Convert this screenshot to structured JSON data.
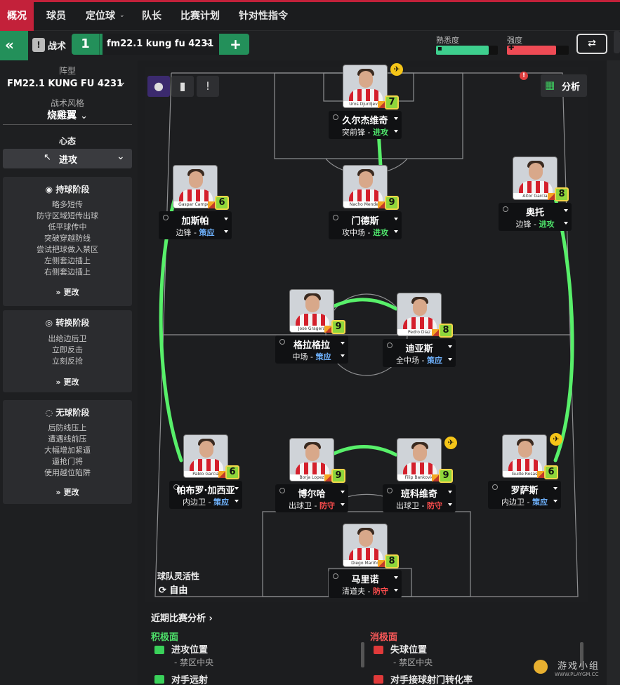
{
  "nav": {
    "tabs": [
      "概况",
      "球员",
      "定位球",
      "队长",
      "比赛计划",
      "针对性指令"
    ],
    "active": "概况"
  },
  "toolbar": {
    "tactics_label": "战术",
    "slot_number": "1",
    "tactic_name": "fm22.1 kung fu 4231",
    "add": "+",
    "familiarity_label": "熟悉度",
    "intensity_label": "强度",
    "familiarity_value": 0.85,
    "intensity_value": 0.8
  },
  "left": {
    "formation_label": "阵型",
    "formation_value": "FM22.1 KUNG FU 4231",
    "style_label": "战术风格",
    "style_value": "烧雞翼",
    "mentality_label": "心态",
    "mentality_value": "进攻",
    "in_possession": {
      "title": "持球阶段",
      "items": [
        "略多短传",
        "防守区域短传出球",
        "低平球传中",
        "突破穿越防线",
        "尝试把球做入禁区",
        "左侧套边插上",
        "右侧套边插上"
      ],
      "change": "更改"
    },
    "transition": {
      "title": "转换阶段",
      "items": [
        "出给边后卫",
        "立即反击",
        "立刻反抢"
      ],
      "change": "更改"
    },
    "out_possession": {
      "title": "无球阶段",
      "items": [
        "后防线压上",
        "遭遇线前压",
        "大幅增加紧逼",
        "逼抢门将",
        "使用越位陷阱"
      ],
      "change": "更改"
    }
  },
  "pitch": {
    "analysis_label": "分析",
    "fluidity_label": "球队灵活性",
    "fluidity_value": "自由"
  },
  "players": [
    {
      "name": "久尔杰维奇",
      "role": "突前锋",
      "duty": "进攻",
      "rating": "7",
      "caption": "Uros Djurdjevic"
    },
    {
      "name": "加斯帕",
      "role": "边锋",
      "duty": "策应",
      "rating": "6",
      "caption": "Gaspar Campos"
    },
    {
      "name": "门德斯",
      "role": "攻中场",
      "duty": "进攻",
      "rating": "9",
      "caption": "Nacho Mendez"
    },
    {
      "name": "奥托",
      "role": "边锋",
      "duty": "进攻",
      "rating": "8",
      "caption": "Aitor Garcia"
    },
    {
      "name": "格拉格拉",
      "role": "中场",
      "duty": "策应",
      "rating": "9",
      "caption": "Jose Gragera"
    },
    {
      "name": "迪亚斯",
      "role": "全中场",
      "duty": "策应",
      "rating": "8",
      "caption": "Pedro Diaz"
    },
    {
      "name": "帕布罗·加西亚",
      "role": "内边卫",
      "duty": "策应",
      "rating": "6",
      "caption": "Pablo Garcia"
    },
    {
      "name": "博尔哈",
      "role": "出球卫",
      "duty": "防守",
      "rating": "9",
      "caption": "Borja Lopez"
    },
    {
      "name": "班科维奇",
      "role": "出球卫",
      "duty": "防守",
      "rating": "9",
      "caption": "Filip Bankovic"
    },
    {
      "name": "罗萨斯",
      "role": "内边卫",
      "duty": "策应",
      "rating": "6",
      "caption": "Guille Rosas"
    },
    {
      "name": "马里诺",
      "role": "清道夫",
      "duty": "防守",
      "rating": "8",
      "caption": "Diego Mariño"
    }
  ],
  "analysis": {
    "title": "近期比赛分析",
    "positive_label": "积极面",
    "negative_label": "消极面",
    "positive": [
      {
        "title": "进攻位置",
        "sub": "- 禁区中央"
      },
      {
        "title": "对手远射",
        "sub": ""
      }
    ],
    "negative": [
      {
        "title": "失球位置",
        "sub": "- 禁区中央"
      },
      {
        "title": "对手接球射门转化率",
        "sub": ""
      }
    ]
  },
  "watermark": {
    "text": "游戏小组",
    "url": "WWW.PLAYGM.CC"
  },
  "colors": {
    "accent": "#c3213a",
    "link_green": "#58f06a",
    "attack": "#4ee26a",
    "support": "#6fb3ff",
    "defend": "#ff4d4d",
    "familiarity": "#3ecf8e",
    "intensity": "#ef4b55"
  }
}
